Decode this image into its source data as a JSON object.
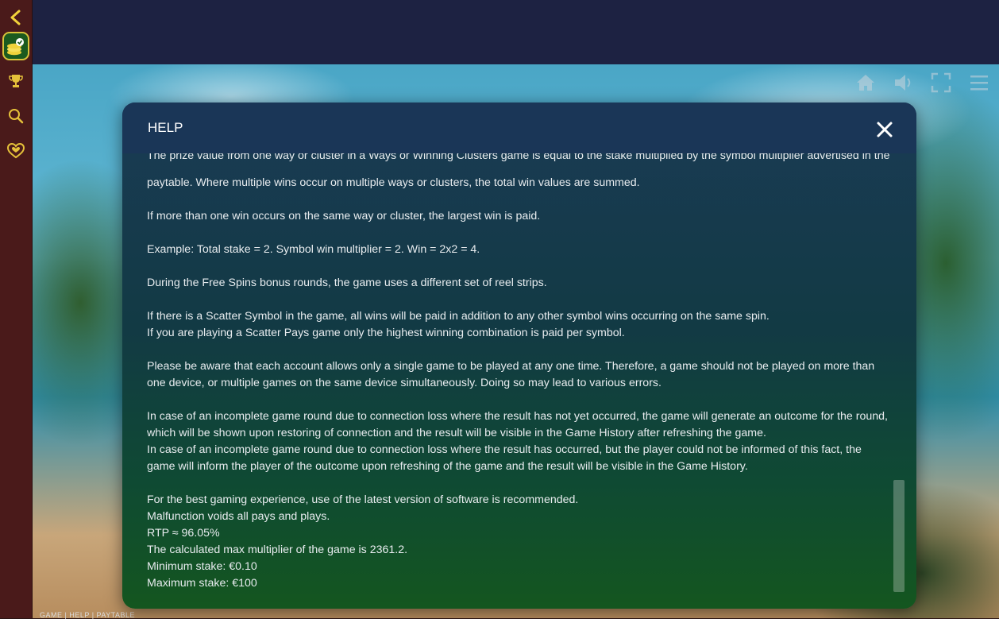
{
  "sidebar": {
    "items": [
      {
        "icon": "chevron-left-icon"
      },
      {
        "icon": "coin-stack-icon"
      },
      {
        "icon": "trophy-icon"
      },
      {
        "icon": "search-icon"
      },
      {
        "icon": "heart-icon"
      }
    ],
    "active_color": "#d7c23a"
  },
  "game_controls": [
    "home-icon",
    "speaker-icon",
    "fullscreen-icon",
    "menu-icon"
  ],
  "modal": {
    "title": "HELP",
    "close_icon": "close-icon",
    "cut_line": "The prize value from one way or cluster in a Ways or Winning Clusters game is equal to the stake multiplied by the symbol multiplier advertised in the",
    "paragraphs": [
      [
        "paytable. Where multiple wins occur on multiple ways or clusters, the total win values are summed."
      ],
      [
        "If more than one win occurs on the same way or cluster, the largest win is paid."
      ],
      [
        "Example: Total stake = 2. Symbol win multiplier = 2. Win = 2x2 = 4."
      ],
      [
        "During the Free Spins bonus rounds, the game uses a different set of reel strips."
      ],
      [
        "If there is a Scatter Symbol in the game, all wins will be paid in addition to any other symbol wins occurring on the same spin.",
        "If you are playing a Scatter Pays game only the highest winning combination is paid per symbol."
      ],
      [
        "Please be aware that each account allows only a single game to be played at any one time. Therefore, a game should not be played on more than",
        "one device, or multiple games on the same device simultaneously. Doing so may lead to various errors."
      ],
      [
        "In case of an incomplete game round due to connection loss where the result has not yet occurred, the game will generate an outcome for the round,",
        "which will be shown upon restoring of connection and the result will be visible in the Game History after refreshing the game.",
        "In case of an incomplete game round due to connection loss where the result has occurred, but the player could not be informed of this fact, the",
        "game will inform the player of the outcome upon refreshing of the game and the result will be visible in the Game History."
      ],
      [
        "For the best gaming experience, use of the latest version of software is recommended.",
        "Malfunction voids all pays and plays.",
        "RTP ≈ 96.05%",
        "The calculated max multiplier of the game is 2361.2.",
        "Minimum stake: €0.10",
        "Maximum stake: €100"
      ]
    ]
  },
  "bottom_strip": "GAME | HELP | PAYTABLE"
}
